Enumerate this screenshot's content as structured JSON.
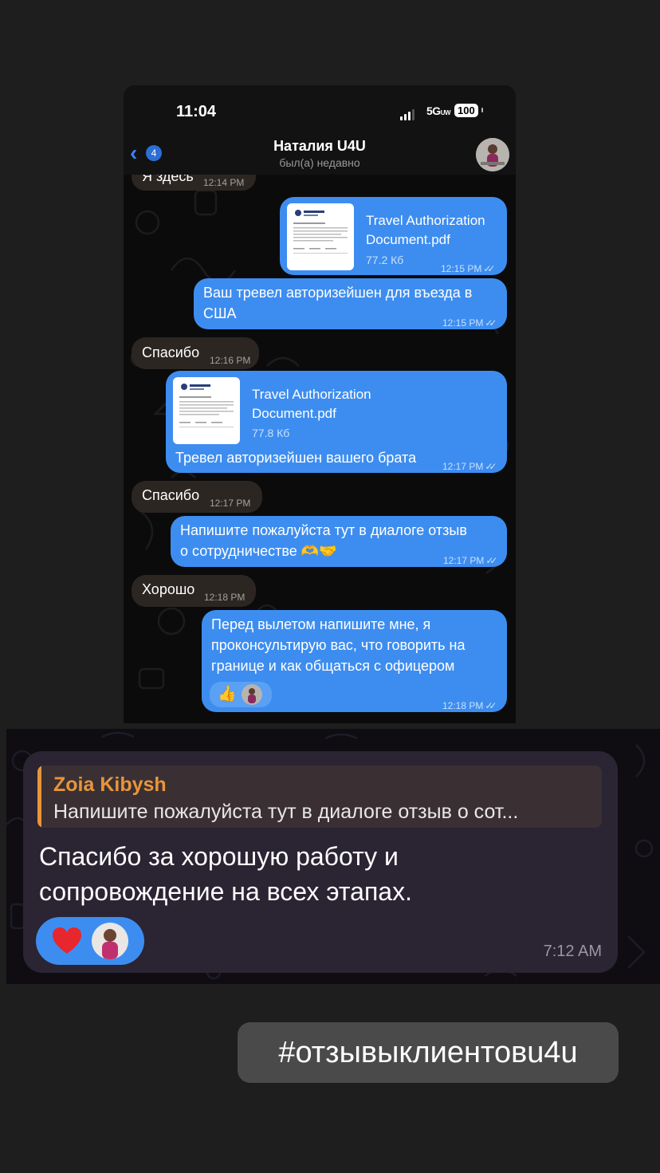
{
  "status_bar": {
    "time": "11:04",
    "network": "5G",
    "network_sub": "UW",
    "battery": "100"
  },
  "chat": {
    "back_count": "4",
    "contact_name": "Наталия U4U",
    "contact_status": "был(а) недавно",
    "messages": [
      {
        "type": "text",
        "dir": "in",
        "text": "Я здесь",
        "time": "12:14 PM"
      },
      {
        "type": "file",
        "dir": "out",
        "file_name_1": "Travel Authorization",
        "file_name_2": "Document.pdf",
        "size": "77.2 Кб",
        "time": "12:15 PM"
      },
      {
        "type": "text",
        "dir": "out",
        "line1": "Ваш тревел авторизейшен для въезда в",
        "line2": "США",
        "time": "12:15 PM"
      },
      {
        "type": "text",
        "dir": "in",
        "text": "Спасибо",
        "time": "12:16 PM"
      },
      {
        "type": "file",
        "dir": "out",
        "file_name_1": "Travel Authorization",
        "file_name_2": "Document.pdf",
        "size": "77.8 Кб",
        "caption": "Тревел авторизейшен вашего брата",
        "time": "12:17 PM"
      },
      {
        "type": "text",
        "dir": "in",
        "text": "Спасибо",
        "time": "12:17 PM"
      },
      {
        "type": "text",
        "dir": "out",
        "line1": "Напишите пожалуйста тут в диалоге отзыв",
        "line2": "о сотрудничестве 🫶🤝",
        "time": "12:17 PM"
      },
      {
        "type": "text",
        "dir": "in",
        "text": "Хорошо",
        "time": "12:18 PM"
      },
      {
        "type": "text",
        "dir": "out",
        "line1": "Перед вылетом напишите мне, я",
        "line2": "проконсультирую вас, что говорить на",
        "line3": "границе и как общаться с офицером",
        "reaction": "👍",
        "time": "12:18 PM"
      }
    ]
  },
  "review": {
    "quote_author": "Zoia Kibysh",
    "quote_text": "Напишите пожалуйста тут в диалоге отзыв о сот...",
    "line1": "Спасибо за хорошую работу и",
    "line2": "сопровождение на всех этапах.",
    "reaction": "❤️",
    "time": "7:12 AM"
  },
  "hashtag": "#отзывыклиентовu4u",
  "colors": {
    "outgoing": "#3d8df0",
    "incoming": "#2c2623",
    "quote_accent": "#e8953a",
    "review_bubble": "#2a2433"
  }
}
